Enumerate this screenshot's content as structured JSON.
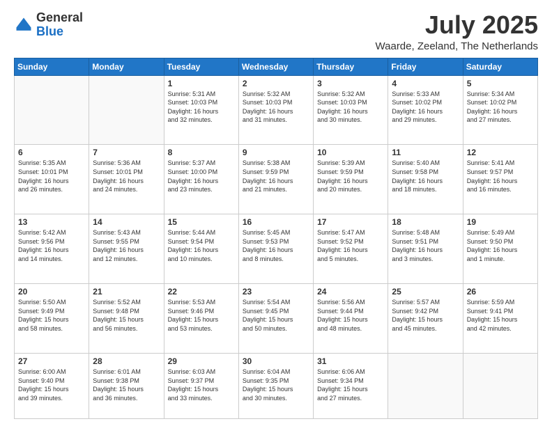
{
  "header": {
    "logo_general": "General",
    "logo_blue": "Blue",
    "month_year": "July 2025",
    "location": "Waarde, Zeeland, The Netherlands"
  },
  "weekdays": [
    "Sunday",
    "Monday",
    "Tuesday",
    "Wednesday",
    "Thursday",
    "Friday",
    "Saturday"
  ],
  "weeks": [
    [
      {
        "day": "",
        "info": ""
      },
      {
        "day": "",
        "info": ""
      },
      {
        "day": "1",
        "info": "Sunrise: 5:31 AM\nSunset: 10:03 PM\nDaylight: 16 hours\nand 32 minutes."
      },
      {
        "day": "2",
        "info": "Sunrise: 5:32 AM\nSunset: 10:03 PM\nDaylight: 16 hours\nand 31 minutes."
      },
      {
        "day": "3",
        "info": "Sunrise: 5:32 AM\nSunset: 10:03 PM\nDaylight: 16 hours\nand 30 minutes."
      },
      {
        "day": "4",
        "info": "Sunrise: 5:33 AM\nSunset: 10:02 PM\nDaylight: 16 hours\nand 29 minutes."
      },
      {
        "day": "5",
        "info": "Sunrise: 5:34 AM\nSunset: 10:02 PM\nDaylight: 16 hours\nand 27 minutes."
      }
    ],
    [
      {
        "day": "6",
        "info": "Sunrise: 5:35 AM\nSunset: 10:01 PM\nDaylight: 16 hours\nand 26 minutes."
      },
      {
        "day": "7",
        "info": "Sunrise: 5:36 AM\nSunset: 10:01 PM\nDaylight: 16 hours\nand 24 minutes."
      },
      {
        "day": "8",
        "info": "Sunrise: 5:37 AM\nSunset: 10:00 PM\nDaylight: 16 hours\nand 23 minutes."
      },
      {
        "day": "9",
        "info": "Sunrise: 5:38 AM\nSunset: 9:59 PM\nDaylight: 16 hours\nand 21 minutes."
      },
      {
        "day": "10",
        "info": "Sunrise: 5:39 AM\nSunset: 9:59 PM\nDaylight: 16 hours\nand 20 minutes."
      },
      {
        "day": "11",
        "info": "Sunrise: 5:40 AM\nSunset: 9:58 PM\nDaylight: 16 hours\nand 18 minutes."
      },
      {
        "day": "12",
        "info": "Sunrise: 5:41 AM\nSunset: 9:57 PM\nDaylight: 16 hours\nand 16 minutes."
      }
    ],
    [
      {
        "day": "13",
        "info": "Sunrise: 5:42 AM\nSunset: 9:56 PM\nDaylight: 16 hours\nand 14 minutes."
      },
      {
        "day": "14",
        "info": "Sunrise: 5:43 AM\nSunset: 9:55 PM\nDaylight: 16 hours\nand 12 minutes."
      },
      {
        "day": "15",
        "info": "Sunrise: 5:44 AM\nSunset: 9:54 PM\nDaylight: 16 hours\nand 10 minutes."
      },
      {
        "day": "16",
        "info": "Sunrise: 5:45 AM\nSunset: 9:53 PM\nDaylight: 16 hours\nand 8 minutes."
      },
      {
        "day": "17",
        "info": "Sunrise: 5:47 AM\nSunset: 9:52 PM\nDaylight: 16 hours\nand 5 minutes."
      },
      {
        "day": "18",
        "info": "Sunrise: 5:48 AM\nSunset: 9:51 PM\nDaylight: 16 hours\nand 3 minutes."
      },
      {
        "day": "19",
        "info": "Sunrise: 5:49 AM\nSunset: 9:50 PM\nDaylight: 16 hours\nand 1 minute."
      }
    ],
    [
      {
        "day": "20",
        "info": "Sunrise: 5:50 AM\nSunset: 9:49 PM\nDaylight: 15 hours\nand 58 minutes."
      },
      {
        "day": "21",
        "info": "Sunrise: 5:52 AM\nSunset: 9:48 PM\nDaylight: 15 hours\nand 56 minutes."
      },
      {
        "day": "22",
        "info": "Sunrise: 5:53 AM\nSunset: 9:46 PM\nDaylight: 15 hours\nand 53 minutes."
      },
      {
        "day": "23",
        "info": "Sunrise: 5:54 AM\nSunset: 9:45 PM\nDaylight: 15 hours\nand 50 minutes."
      },
      {
        "day": "24",
        "info": "Sunrise: 5:56 AM\nSunset: 9:44 PM\nDaylight: 15 hours\nand 48 minutes."
      },
      {
        "day": "25",
        "info": "Sunrise: 5:57 AM\nSunset: 9:42 PM\nDaylight: 15 hours\nand 45 minutes."
      },
      {
        "day": "26",
        "info": "Sunrise: 5:59 AM\nSunset: 9:41 PM\nDaylight: 15 hours\nand 42 minutes."
      }
    ],
    [
      {
        "day": "27",
        "info": "Sunrise: 6:00 AM\nSunset: 9:40 PM\nDaylight: 15 hours\nand 39 minutes."
      },
      {
        "day": "28",
        "info": "Sunrise: 6:01 AM\nSunset: 9:38 PM\nDaylight: 15 hours\nand 36 minutes."
      },
      {
        "day": "29",
        "info": "Sunrise: 6:03 AM\nSunset: 9:37 PM\nDaylight: 15 hours\nand 33 minutes."
      },
      {
        "day": "30",
        "info": "Sunrise: 6:04 AM\nSunset: 9:35 PM\nDaylight: 15 hours\nand 30 minutes."
      },
      {
        "day": "31",
        "info": "Sunrise: 6:06 AM\nSunset: 9:34 PM\nDaylight: 15 hours\nand 27 minutes."
      },
      {
        "day": "",
        "info": ""
      },
      {
        "day": "",
        "info": ""
      }
    ]
  ]
}
